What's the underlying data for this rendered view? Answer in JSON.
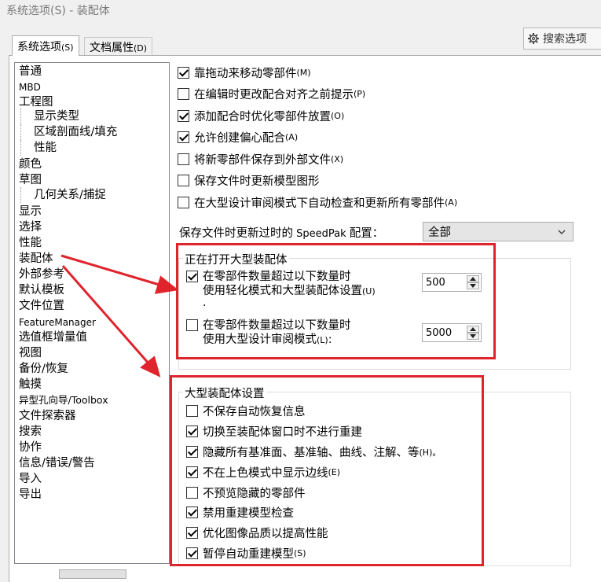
{
  "window": {
    "title": "系统选项(S) - 装配体"
  },
  "search": {
    "label": "搜索选项",
    "icon": "gear-search-icon"
  },
  "tabs": [
    {
      "label": "系统选项",
      "accel": "(S)",
      "active": true
    },
    {
      "label": "文档属性",
      "accel": "(D)",
      "active": false
    }
  ],
  "sidebar": {
    "items": [
      {
        "label": "普通"
      },
      {
        "label": "MBD"
      },
      {
        "label": "工程图"
      },
      {
        "label": "显示类型"
      },
      {
        "label": "区域剖面线/填充"
      },
      {
        "label": "性能"
      },
      {
        "label": "颜色"
      },
      {
        "label": "草图"
      },
      {
        "label": "几何关系/捕捉"
      },
      {
        "label": "显示"
      },
      {
        "label": "选择"
      },
      {
        "label": "性能"
      },
      {
        "label": "装配体",
        "selected": true
      },
      {
        "label": "外部参考"
      },
      {
        "label": "默认模板"
      },
      {
        "label": "文件位置"
      },
      {
        "label": "FeatureManager"
      },
      {
        "label": "选值框增量值"
      },
      {
        "label": "视图"
      },
      {
        "label": "备份/恢复"
      },
      {
        "label": "触摸"
      },
      {
        "label": "异型孔向导/Toolbox"
      },
      {
        "label": "文件探索器"
      },
      {
        "label": "搜索"
      },
      {
        "label": "协作"
      },
      {
        "label": "信息/错误/警告"
      },
      {
        "label": "导入"
      },
      {
        "label": "导出"
      }
    ]
  },
  "options": [
    {
      "label": "靠拖动来移动零部件",
      "accel": "(M)",
      "checked": true
    },
    {
      "label": "在编辑时更改配合对齐之前提示",
      "accel": "(P)",
      "checked": false
    },
    {
      "label": "添加配合时优化零部件放置",
      "accel": "(O)",
      "checked": true
    },
    {
      "label": "允许创建偏心配合",
      "accel": "(A)",
      "checked": true
    },
    {
      "label": "将新零部件保存到外部文件",
      "accel": "(X)",
      "checked": false
    },
    {
      "label": "保存文件时更新模型图形",
      "accel": "",
      "checked": false
    },
    {
      "label": "在大型设计审阅模式下自动检查和更新所有零部件",
      "accel": "(A)",
      "checked": false
    }
  ],
  "speedpak": {
    "label_prefix": "保存文件时更新过时的",
    "label_latin": " SpeedPak ",
    "label_suffix": "配置：",
    "value": "全部"
  },
  "large_open": {
    "title": "正在打开大型装配体",
    "rows": [
      {
        "line1": "在零部件数量超过以下数量时",
        "line2": "使用轻化模式和大型装配体设置",
        "accel": "(U)",
        "tail": ".",
        "checked": true,
        "value": "500"
      },
      {
        "line1": "在零部件数量超过以下数量时",
        "line2": "使用大型设计审阅模式",
        "accel": "(L)",
        "tail": ":",
        "checked": false,
        "value": "5000"
      }
    ]
  },
  "large_settings": {
    "title": "大型装配体设置",
    "items": [
      {
        "label": "不保存自动恢复信息",
        "accel": "",
        "checked": false
      },
      {
        "label": "切换至装配体窗口时不进行重建",
        "accel": "",
        "checked": true
      },
      {
        "label": "隐藏所有基准面、基准轴、曲线、注解、等",
        "accel": "(H)。",
        "checked": true
      },
      {
        "label": "不在上色模式中显示边线",
        "accel": "(E)",
        "checked": true
      },
      {
        "label": "不预览隐藏的零部件",
        "accel": "",
        "checked": false
      },
      {
        "label": "禁用重建模型检查",
        "accel": "",
        "checked": true
      },
      {
        "label": "优化图像品质以提高性能",
        "accel": "",
        "checked": true
      },
      {
        "label": "暂停自动重建模型",
        "accel": "(S)",
        "checked": true
      }
    ]
  },
  "colors": {
    "highlight_red": "#e0242c",
    "border": "#adadad"
  }
}
